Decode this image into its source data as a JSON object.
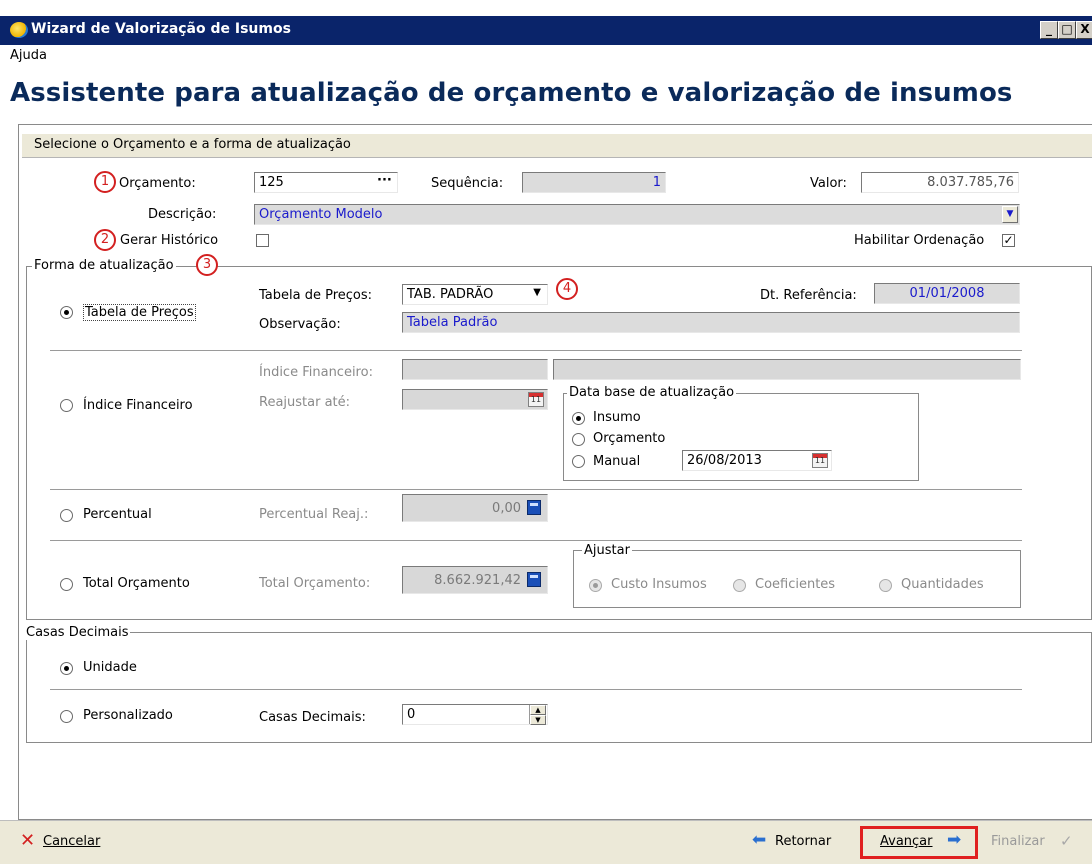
{
  "window": {
    "title": "Wizard de Valorização de Isumos",
    "buttons": [
      "_",
      "□",
      "X"
    ]
  },
  "menu": {
    "items": [
      "Ajuda"
    ]
  },
  "heading": "Assistente para atualização de orçamento e valorização de insumos",
  "section_title": "Selecione o Orçamento e a forma de atualização",
  "budget": {
    "orcamento_label": "Orçamento:",
    "orcamento_value": "125",
    "lookup_button": "···",
    "sequencia_label": "Sequência:",
    "sequencia_value": "1",
    "valor_label": "Valor:",
    "valor_value": "8.037.785,76",
    "descricao_label": "Descrição:",
    "descricao_value": "Orçamento Modelo",
    "gerar_historico_label": "Gerar Histórico",
    "gerar_historico_checked": false,
    "habilitar_ordenacao_label": "Habilitar Ordenação",
    "habilitar_ordenacao_checked": true
  },
  "markers": [
    "1",
    "2",
    "3",
    "4"
  ],
  "forma": {
    "legend": "Forma de atualização",
    "tabela": {
      "radio_label": "Tabela de Preços",
      "selected": true,
      "tabela_label": "Tabela de Preços:",
      "tabela_value": "TAB. PADRÃO",
      "dt_ref_label": "Dt. Referência:",
      "dt_ref_value": "01/01/2008",
      "obs_label": "Observação:",
      "obs_value": "Tabela Padrão"
    },
    "indice": {
      "radio_label": "Índice Financeiro",
      "indice_label": "Índice Financeiro:",
      "reajustar_label": "Reajustar até:",
      "data_base_legend": "Data base de atualização",
      "opt_insumo": "Insumo",
      "opt_orcamento": "Orçamento",
      "opt_manual": "Manual",
      "manual_date": "26/08/2013",
      "selected_option": "Insumo"
    },
    "percentual": {
      "radio_label": "Percentual",
      "reaj_label": "Percentual Reaj.:",
      "reaj_value": "0,00"
    },
    "total": {
      "radio_label": "Total Orçamento",
      "total_label": "Total Orçamento:",
      "total_value": "8.662.921,42",
      "ajustar_legend": "Ajustar",
      "opt_custo": "Custo Insumos",
      "opt_coef": "Coeficientes",
      "opt_quant": "Quantidades"
    }
  },
  "casas": {
    "legend": "Casas Decimais",
    "unidade_label": "Unidade",
    "personalizado_label": "Personalizado",
    "casas_label": "Casas Decimais:",
    "casas_value": "0"
  },
  "footer": {
    "cancelar": "Cancelar",
    "retornar": "Retornar",
    "avancar": "Avançar",
    "finalizar": "Finalizar"
  },
  "colors": {
    "title_bar": "#0a246a",
    "heading": "#0a2a5a",
    "marker": "#d32020",
    "highlight": "#e02020"
  }
}
